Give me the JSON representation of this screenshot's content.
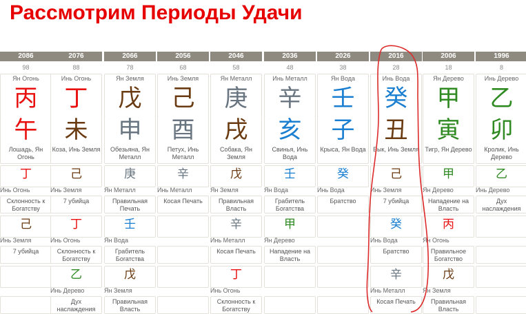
{
  "title": "Рассмотрим Периоды Удачи",
  "colors": {
    "red": "#e8110f",
    "brown": "#6a3a10",
    "gray": "#687580",
    "blue": "#1a7fd0",
    "green": "#2f8a22",
    "annotation": "#dd2b2b"
  },
  "columns": [
    {
      "year": "2086",
      "age": "98",
      "stem_el": "Ян Огонь",
      "stem": "丙",
      "stem_color": "red",
      "branch": "午",
      "branch_color": "red",
      "branch_el": "Лошадь, Ян Огонь",
      "h1": {
        "ch": "丁",
        "color": "red",
        "el": "Инь Огонь",
        "note": "Склонность к Богатству"
      },
      "h2": {
        "ch": "己",
        "color": "brown",
        "el": "Инь Земля",
        "note": "7 убийца"
      },
      "h3": {
        "ch": "",
        "color": "",
        "el": "",
        "note": ""
      }
    },
    {
      "year": "2076",
      "age": "88",
      "stem_el": "Инь Огонь",
      "stem": "丁",
      "stem_color": "red",
      "branch": "未",
      "branch_color": "brown",
      "branch_el": "Коза, Инь Земля",
      "h1": {
        "ch": "己",
        "color": "brown",
        "el": "Инь Земля",
        "note": "7 убийца"
      },
      "h2": {
        "ch": "丁",
        "color": "red",
        "el": "Инь Огонь",
        "note": "Склонность к Богатству"
      },
      "h3": {
        "ch": "乙",
        "color": "green",
        "el": "Инь Дерево",
        "note": "Дух наслаждения"
      }
    },
    {
      "year": "2066",
      "age": "78",
      "stem_el": "Ян Земля",
      "stem": "戊",
      "stem_color": "brown",
      "branch": "申",
      "branch_color": "gray",
      "branch_el": "Обезьяна, Ян Металл",
      "h1": {
        "ch": "庚",
        "color": "gray",
        "el": "Ян Металл",
        "note": "Правильная Печать"
      },
      "h2": {
        "ch": "壬",
        "color": "blue",
        "el": "Ян Вода",
        "note": "Грабитель Богатства"
      },
      "h3": {
        "ch": "戊",
        "color": "brown",
        "el": "Ян Земля",
        "note": "Правильная Власть"
      }
    },
    {
      "year": "2056",
      "age": "68",
      "stem_el": "Инь Земля",
      "stem": "己",
      "stem_color": "brown",
      "branch": "酉",
      "branch_color": "gray",
      "branch_el": "Петух, Инь Металл",
      "h1": {
        "ch": "辛",
        "color": "gray",
        "el": "Инь Металл",
        "note": "Косая Печать"
      },
      "h2": {
        "ch": "",
        "color": "",
        "el": "",
        "note": ""
      },
      "h3": {
        "ch": "",
        "color": "",
        "el": "",
        "note": ""
      }
    },
    {
      "year": "2046",
      "age": "58",
      "stem_el": "Ян Металл",
      "stem": "庚",
      "stem_color": "gray",
      "branch": "戌",
      "branch_color": "brown",
      "branch_el": "Собака, Ян Земля",
      "h1": {
        "ch": "戊",
        "color": "brown",
        "el": "Ян Земля",
        "note": "Правильная Власть"
      },
      "h2": {
        "ch": "辛",
        "color": "gray",
        "el": "Инь Металл",
        "note": "Косая Печать"
      },
      "h3": {
        "ch": "丁",
        "color": "red",
        "el": "Инь Огонь",
        "note": "Склонность к Богатству"
      }
    },
    {
      "year": "2036",
      "age": "48",
      "stem_el": "Инь Металл",
      "stem": "辛",
      "stem_color": "gray",
      "branch": "亥",
      "branch_color": "blue",
      "branch_el": "Свинья, Инь Вода",
      "h1": {
        "ch": "壬",
        "color": "blue",
        "el": "Ян Вода",
        "note": "Грабитель Богатства"
      },
      "h2": {
        "ch": "甲",
        "color": "green",
        "el": "Ян Дерево",
        "note": "Нападение на Власть"
      },
      "h3": {
        "ch": "",
        "color": "",
        "el": "",
        "note": ""
      }
    },
    {
      "year": "2026",
      "age": "38",
      "stem_el": "Ян Вода",
      "stem": "壬",
      "stem_color": "blue",
      "branch": "子",
      "branch_color": "blue",
      "branch_el": "Крыса, Ян Вода",
      "h1": {
        "ch": "癸",
        "color": "blue",
        "el": "Инь Вода",
        "note": "Братство"
      },
      "h2": {
        "ch": "",
        "color": "",
        "el": "",
        "note": ""
      },
      "h3": {
        "ch": "",
        "color": "",
        "el": "",
        "note": ""
      }
    },
    {
      "year": "2016",
      "age": "28",
      "stem_el": "Инь Вода",
      "stem": "癸",
      "stem_color": "blue",
      "branch": "丑",
      "branch_color": "brown",
      "branch_el": "Бык, Инь Земля",
      "h1": {
        "ch": "己",
        "color": "brown",
        "el": "Инь Земля",
        "note": "7 убийца"
      },
      "h2": {
        "ch": "癸",
        "color": "blue",
        "el": "Инь Вода",
        "note": "Братство"
      },
      "h3": {
        "ch": "辛",
        "color": "gray",
        "el": "Инь Металл",
        "note": "Косая Печать"
      }
    },
    {
      "year": "2006",
      "age": "18",
      "stem_el": "Ян Дерево",
      "stem": "甲",
      "stem_color": "green",
      "branch": "寅",
      "branch_color": "green",
      "branch_el": "Тигр, Ян Дерево",
      "h1": {
        "ch": "甲",
        "color": "green",
        "el": "Ян Дерево",
        "note": "Нападение на Власть"
      },
      "h2": {
        "ch": "丙",
        "color": "red",
        "el": "Ян Огонь",
        "note": "Правильное Богатство"
      },
      "h3": {
        "ch": "戊",
        "color": "brown",
        "el": "Ян Земля",
        "note": "Правильная Власть"
      }
    },
    {
      "year": "1996",
      "age": "8",
      "stem_el": "Инь Дерево",
      "stem": "乙",
      "stem_color": "green",
      "branch": "卯",
      "branch_color": "green",
      "branch_el": "Кролик, Инь Дерево",
      "h1": {
        "ch": "乙",
        "color": "green",
        "el": "Инь Дерево",
        "note": "Дух наслаждения"
      },
      "h2": {
        "ch": "",
        "color": "",
        "el": "",
        "note": ""
      },
      "h3": {
        "ch": "",
        "color": "",
        "el": "",
        "note": ""
      }
    }
  ]
}
